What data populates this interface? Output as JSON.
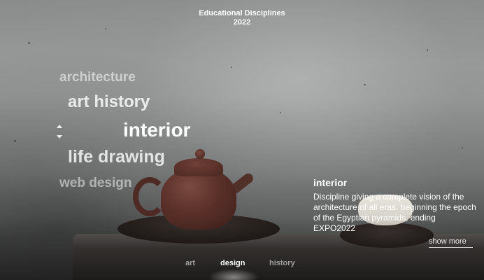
{
  "header": {
    "title_line1": "Educational Disciplines",
    "title_line2": "2022"
  },
  "disciplines": {
    "items": [
      "architecture",
      "art history",
      "interior",
      "life drawing",
      "web design"
    ],
    "selected": "interior"
  },
  "detail": {
    "title": "interior",
    "description": "Discipline giving a complete vision of the architecture of all eras, beginning the epoch of the Egyptian pyramids, ending EXPO2022",
    "show_more_label": "show more"
  },
  "nav": {
    "items": [
      "art",
      "design",
      "history"
    ],
    "active": "design"
  },
  "icons": {
    "scroll_up": "chevron-up-icon",
    "scroll_down": "chevron-down-icon"
  },
  "colors": {
    "text": "#ffffff",
    "muted_text": "#c8c8c8"
  }
}
